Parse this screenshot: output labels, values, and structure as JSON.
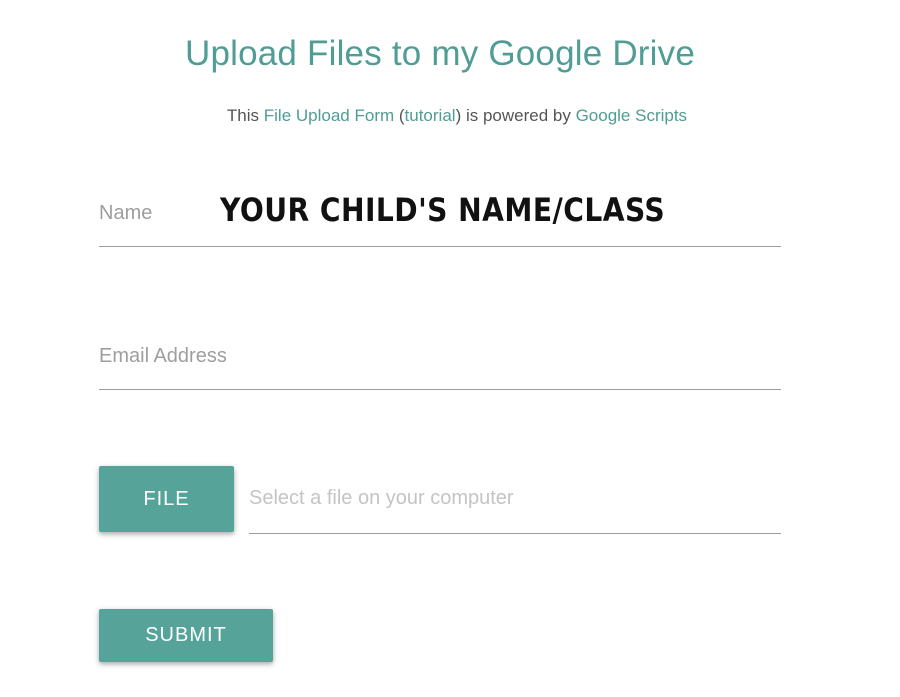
{
  "page": {
    "title": "Upload Files to my Google Drive",
    "subtitle": {
      "prefix": "This ",
      "form_link": "File Upload Form",
      "paren_open": " (",
      "tutorial_link": "tutorial",
      "middle": ") is powered by ",
      "scripts_link": "Google Scripts"
    }
  },
  "form": {
    "name": {
      "label": "Name",
      "overlay_text": "YOUR CHILD'S NAME/CLASS"
    },
    "email": {
      "label": "Email Address"
    },
    "file": {
      "button_label": "FILE",
      "placeholder": "Select a file on your computer"
    },
    "submit": {
      "label": "SUBMIT"
    }
  },
  "colors": {
    "accent": "#4f9d94",
    "button": "#55a399",
    "label": "#9e9e9e",
    "placeholder": "#c4c4c4"
  }
}
